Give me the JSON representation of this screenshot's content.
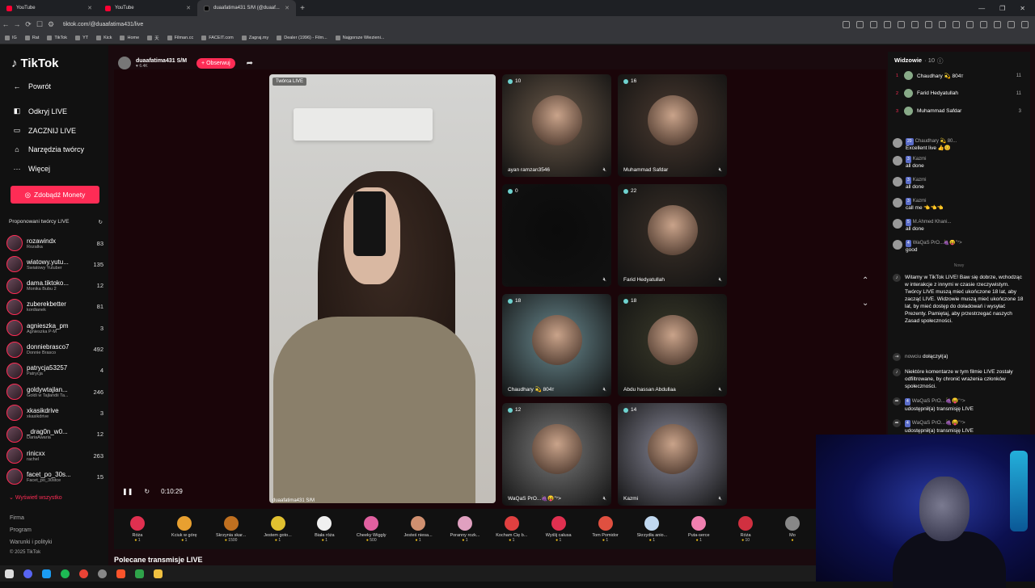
{
  "browser": {
    "tabs": [
      {
        "title": "YouTube"
      },
      {
        "title": "YouTube"
      },
      {
        "title": "duaafatima431 S/M (@duaaf..."
      }
    ],
    "url": "tiktok.com/@duaafatima431/live",
    "bookmarks": [
      "IG",
      "Rat",
      "TikTok",
      "YT",
      "Kick",
      "Home",
      "天",
      "Filman.cc",
      "FACEIT.com",
      "Zagraj.my",
      "Dealer (1996) - Film...",
      "Najgorsze Wiezieni..."
    ]
  },
  "sidebar": {
    "logo": "TikTok",
    "nav": [
      {
        "label": "Powrót"
      },
      {
        "label": "Odkryj LIVE"
      },
      {
        "label": "ZACZNIJ LIVE"
      },
      {
        "label": "Narzędzia twórcy"
      },
      {
        "label": "Więcej"
      }
    ],
    "coins_label": "Zdobądź Monety",
    "suggested_header": "Proponowani twórcy LIVE",
    "creators": [
      {
        "name": "rozawindx",
        "sub": "Rozalka",
        "count": "83"
      },
      {
        "name": "wiatowy.yutu...",
        "sub": "Światowy Yutuber",
        "count": "135"
      },
      {
        "name": "dama.tiktoko...",
        "sub": "Monika Bubu 2",
        "count": "12"
      },
      {
        "name": "zuberekbetter",
        "sub": "kordianek",
        "count": "81"
      },
      {
        "name": "agnieszka_pm",
        "sub": "Agnieszka P-M",
        "count": "3"
      },
      {
        "name": "donniebrasco7",
        "sub": "Donnie Brasco",
        "count": "492"
      },
      {
        "name": "patrycja53257",
        "sub": "Patrycja",
        "count": "4"
      },
      {
        "name": "goldywtajlan...",
        "sub": "Goldi w Tajlandii Ta...",
        "count": "246"
      },
      {
        "name": "xkasikdrive",
        "sub": "xkasikdrive",
        "count": "3"
      },
      {
        "name": "_drag0n_w0...",
        "sub": "DariaAwaria",
        "count": "12"
      },
      {
        "name": "rinicxx",
        "sub": "rachel",
        "count": "263"
      },
      {
        "name": "facet_po_30s...",
        "sub": "Facet_po_30stce",
        "count": "15"
      }
    ],
    "show_all": "Wyświetl wszystko",
    "footer": [
      "Firma",
      "Program",
      "Warunki i polityki",
      "© 2025 TikTok"
    ]
  },
  "host": {
    "name": "duaafatima431 S/M",
    "viewers": "6.4K",
    "follow": "+ Obserwuj"
  },
  "main_video": {
    "tag": "Twórca LIVE",
    "name": "duaafatima431 S/M",
    "time": "0:10:29"
  },
  "guests": [
    {
      "count": "10",
      "name": "ayan ramzan3546"
    },
    {
      "count": "16",
      "name": "Muhammad Safdar"
    },
    {
      "count": "0",
      "name": ""
    },
    {
      "count": "22",
      "name": "Farid Hedyatullah"
    },
    {
      "count": "18",
      "name": "Chaudhary 💫 804т"
    },
    {
      "count": "18",
      "name": "Abdu hassan Abdullaa"
    },
    {
      "count": "12",
      "name": "WaQaS PrO...🍇😝\"⁷>"
    },
    {
      "count": "14",
      "name": "Kazmi"
    }
  ],
  "gifts": [
    {
      "name": "Róża",
      "price": "1"
    },
    {
      "name": "Kciuk w górę",
      "price": "1"
    },
    {
      "name": "Skrzynia skar...",
      "price": "1500"
    },
    {
      "name": "Jestem goto...",
      "price": "1"
    },
    {
      "name": "Biała róża",
      "price": "1"
    },
    {
      "name": "Cheeky Wiggly",
      "price": "500"
    },
    {
      "name": "Jesteś niesa...",
      "price": "1"
    },
    {
      "name": "Poranny rozk...",
      "price": "1"
    },
    {
      "name": "Kocham Cię b...",
      "price": "1"
    },
    {
      "name": "Wyślij całusa",
      "price": "1"
    },
    {
      "name": "Tom Pomidor",
      "price": "1"
    },
    {
      "name": "Skrzydła anio...",
      "price": "1"
    },
    {
      "name": "Puta-serce",
      "price": "1"
    },
    {
      "name": "Róża",
      "price": "10"
    },
    {
      "name": "Mo",
      "price": ""
    }
  ],
  "recommended": "Polecane transmisje LIVE",
  "chat": {
    "viewers_label": "Widzowie",
    "viewers_count": "· 10",
    "top": [
      {
        "rank": "1",
        "name": "Chaudhary 💫 804т",
        "score": "11"
      },
      {
        "rank": "2",
        "name": "Farid Hedyatullah",
        "score": "11"
      },
      {
        "rank": "3",
        "name": "Muhammad Safdar",
        "score": "3"
      }
    ],
    "messages": [
      {
        "badge": "20",
        "user": "Chaudhary 💫 80...",
        "text": "Excellent live 👍😊"
      },
      {
        "badge": "3",
        "user": "Kazmi",
        "text": "all done"
      },
      {
        "badge": "3",
        "user": "Kazmi",
        "text": "all done"
      },
      {
        "badge": "3",
        "user": "Kazmi",
        "text": "call me 👈👈👈"
      },
      {
        "badge": "5",
        "user": "M.Ahmed Khani...",
        "text": "all done"
      },
      {
        "badge": "4",
        "user": "WaQaS PrO...🍇😝\"⁷>",
        "text": "good"
      }
    ],
    "new_label": "Nowy",
    "welcome": "Witamy w TikTok LIVE! Baw się dobrze, wchodząc w interakcje z innymi w czasie rzeczywistym. Twórcy LIVE muszą mieć ukończone 18 lat, aby zacząć LIVE. Widzowie muszą mieć ukończone 18 lat, by mieć dostęp do doładowań i wysyłać Prezenty. Pamiętaj, aby przestrzegać naszych Zasad społeczności.",
    "joined_user": "nowciu",
    "joined_text": "dołączył(a)",
    "filtered": "Niektóre komentarze w tym filmie LIVE zostały odfiltrowane, by chronić wrażenia członków społeczności.",
    "shares": [
      {
        "user": "WaQaS PrO...🍇😝\"⁷>",
        "text": "udostępnił(a) transmisję LIVE"
      },
      {
        "user": "WaQaS PrO...🍇😝\"⁷>",
        "text": "udostępnił(a) transmisję LIVE"
      }
    ]
  }
}
